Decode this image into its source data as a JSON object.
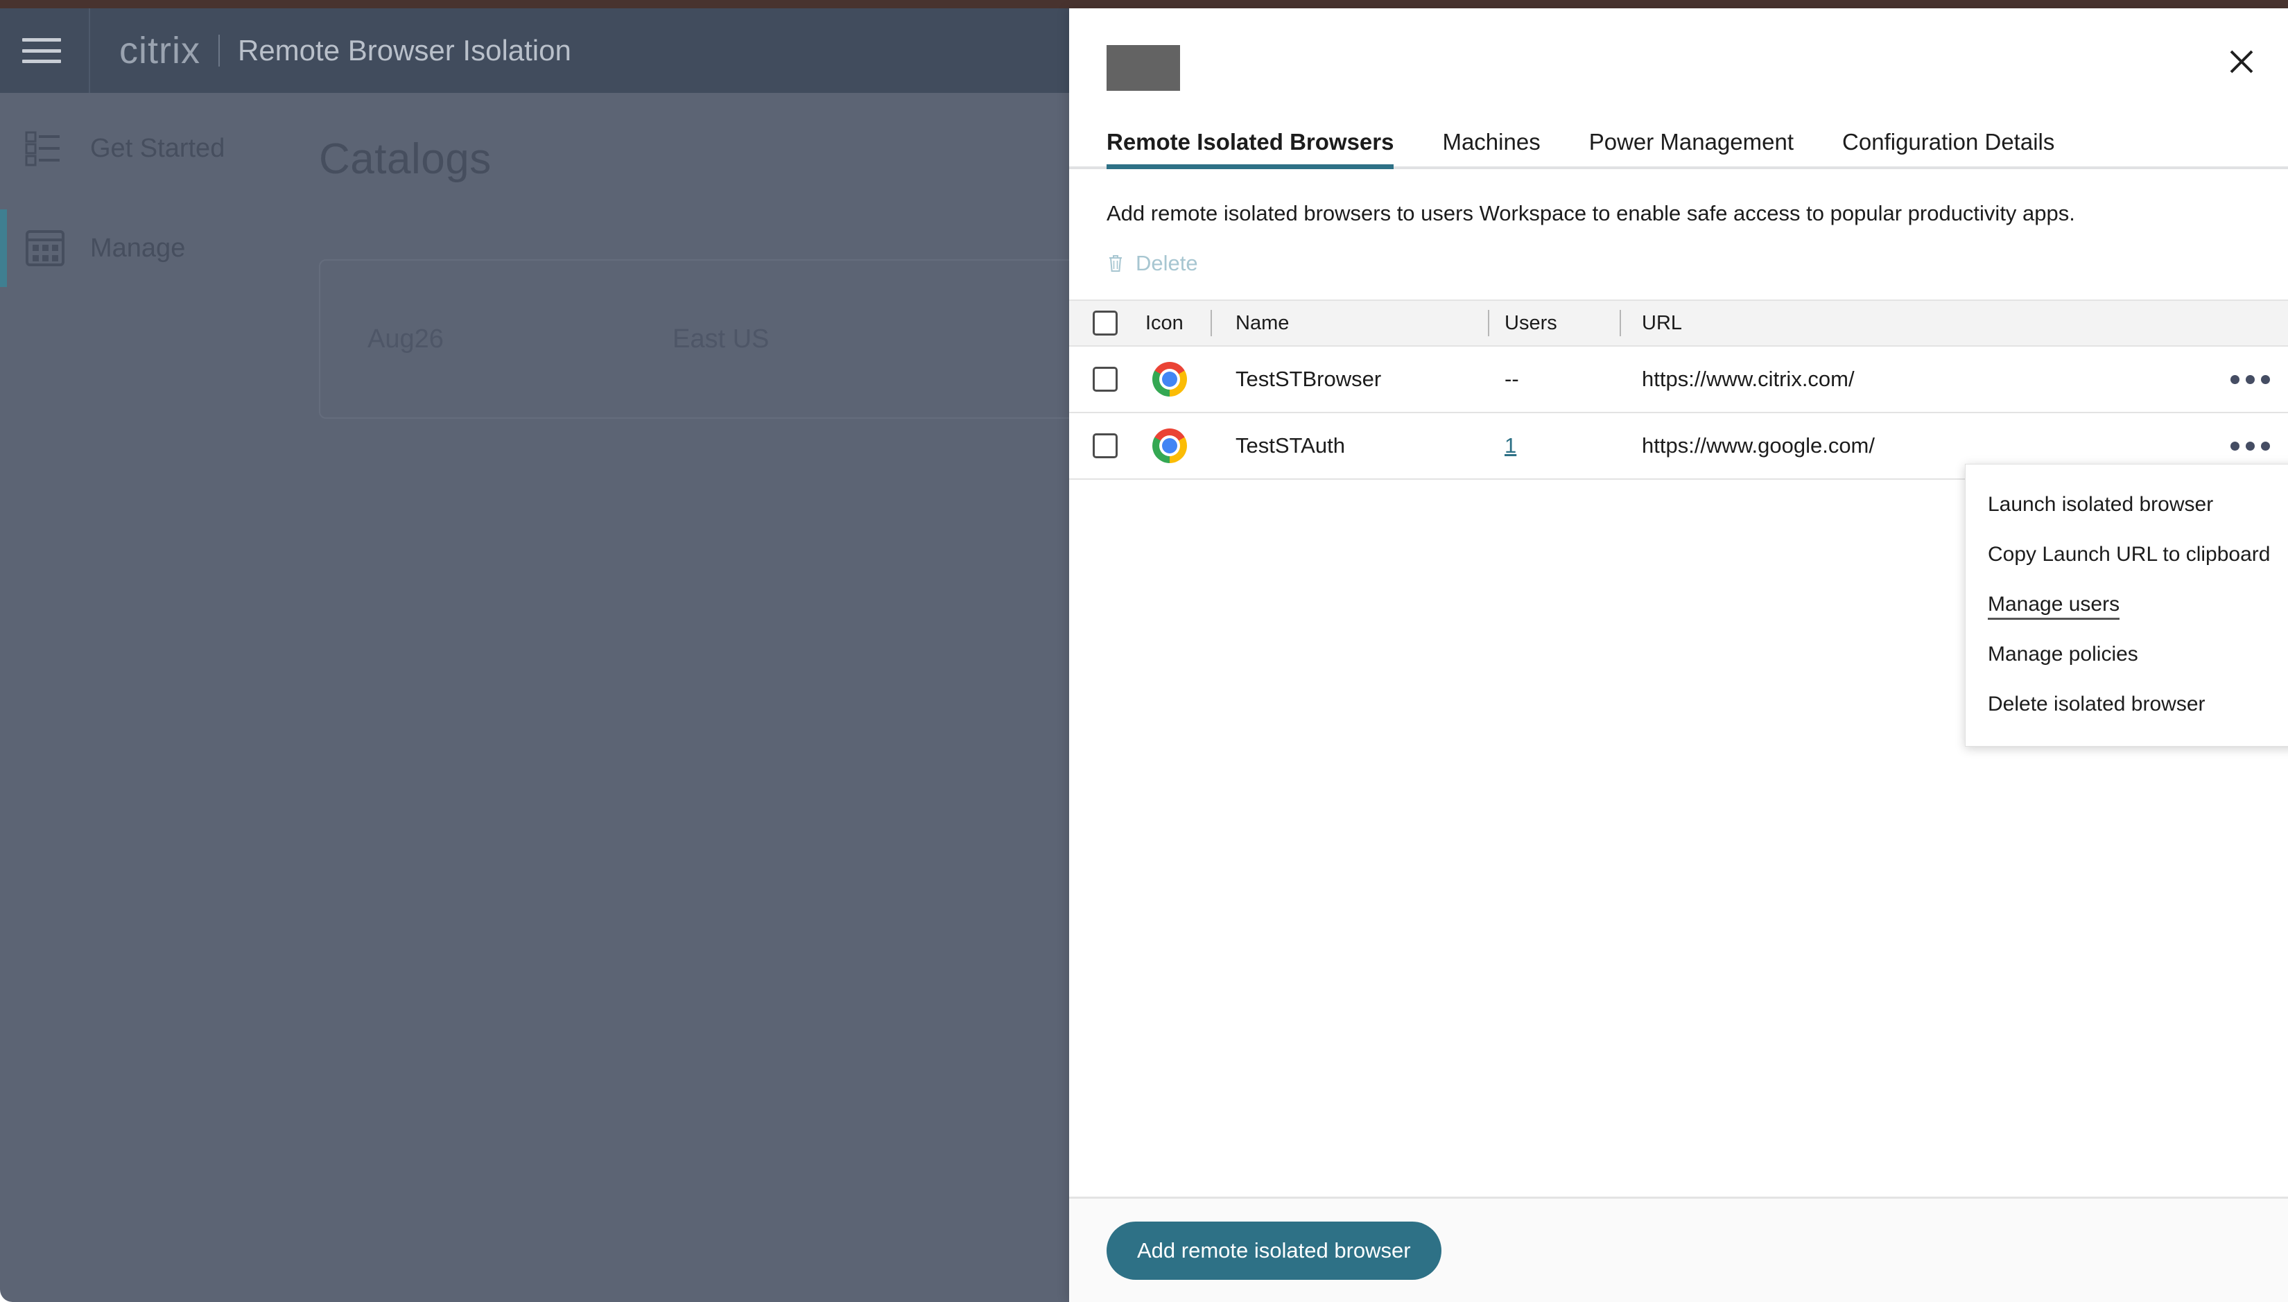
{
  "background": {
    "header": {
      "menu_icon": "hamburger-icon",
      "brand": "citrix",
      "title": "Remote Browser Isolation"
    },
    "sidebar": {
      "items": [
        {
          "label": "Get Started",
          "icon": "checklist-icon",
          "active": false
        },
        {
          "label": "Manage",
          "icon": "grid-icon",
          "active": true
        }
      ]
    },
    "main": {
      "heading": "Catalogs",
      "card": {
        "name": "Aug26",
        "region": "East US"
      }
    }
  },
  "panel": {
    "title_redacted": "",
    "close_icon": "close-icon",
    "tabs": [
      {
        "label": "Remote Isolated Browsers",
        "active": true
      },
      {
        "label": "Machines",
        "active": false
      },
      {
        "label": "Power Management",
        "active": false
      },
      {
        "label": "Configuration Details",
        "active": false
      }
    ],
    "description": "Add remote isolated browsers to users Workspace to enable safe access to popular productivity apps.",
    "toolbar": {
      "delete_label": "Delete",
      "delete_icon": "trash-icon",
      "delete_enabled": false
    },
    "table": {
      "columns": [
        "Icon",
        "Name",
        "Users",
        "URL"
      ],
      "select_all_checked": false,
      "rows": [
        {
          "checked": false,
          "icon": "chrome-icon",
          "name": "TestSTBrowser",
          "users": "--",
          "users_is_link": false,
          "url": "https://www.citrix.com/",
          "menu_icon": "kebab-menu-icon"
        },
        {
          "checked": false,
          "icon": "chrome-icon",
          "name": "TestSTAuth",
          "users": "1",
          "users_is_link": true,
          "url": "https://www.google.com/",
          "menu_icon": "kebab-menu-icon"
        }
      ]
    },
    "context_menu": {
      "visible": true,
      "items": [
        {
          "label": "Launch isolated browser",
          "highlighted": false
        },
        {
          "label": "Copy Launch URL to clipboard",
          "highlighted": false
        },
        {
          "label": "Manage users ",
          "highlighted": true
        },
        {
          "label": "Manage policies",
          "highlighted": false
        },
        {
          "label": "Delete isolated browser",
          "highlighted": false
        }
      ]
    },
    "footer": {
      "primary_button": "Add remote isolated browser"
    }
  },
  "colors": {
    "accent_teal": "#2e7186",
    "header_slate": "#414c5d",
    "body_slate": "#5c6474",
    "top_strip": "#48332f",
    "link_teal": "#2e7186"
  }
}
